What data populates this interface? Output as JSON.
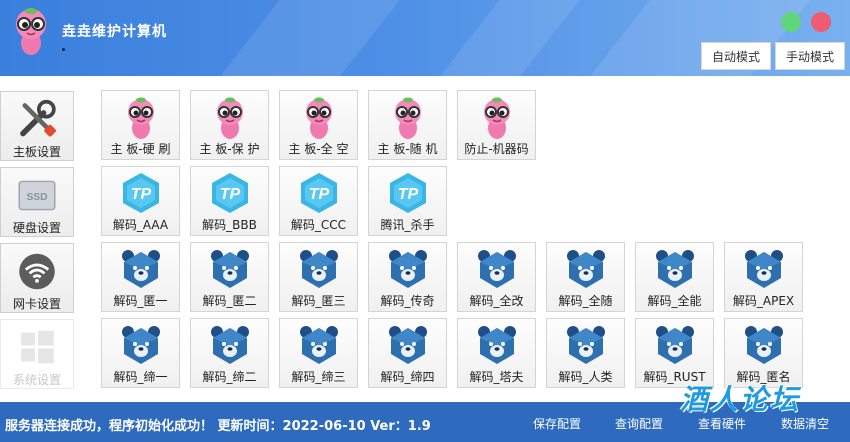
{
  "app": {
    "title": "垚垚维护计算机",
    "dot": "."
  },
  "window": {
    "buttons": [
      "green-button",
      "red-button"
    ]
  },
  "modes": {
    "auto": "自动模式",
    "manual": "手动模式"
  },
  "sidebar": [
    {
      "label": "主板设置",
      "icon": "tools-icon"
    },
    {
      "label": "硬盘设置",
      "icon": "ssd-icon"
    },
    {
      "label": "网卡设置",
      "icon": "wifi-icon"
    },
    {
      "label": "系统设置",
      "icon": "windows-icon"
    }
  ],
  "rows": [
    [
      {
        "label": "主 板-硬 刷",
        "icon": "mascot-icon"
      },
      {
        "label": "主 板-保 护",
        "icon": "mascot-icon"
      },
      {
        "label": "主 板-全 空",
        "icon": "mascot-icon"
      },
      {
        "label": "主 板-随 机",
        "icon": "mascot-icon"
      },
      {
        "label": "防止-机器码",
        "icon": "mascot-icon"
      }
    ],
    [
      {
        "label": "解码_AAA",
        "icon": "tp-icon"
      },
      {
        "label": "解码_BBB",
        "icon": "tp-icon"
      },
      {
        "label": "解码_CCC",
        "icon": "tp-icon"
      },
      {
        "label": "腾讯_杀手",
        "icon": "tp-icon"
      }
    ],
    [
      {
        "label": "解码_匿一",
        "icon": "bear-icon"
      },
      {
        "label": "解码_匿二",
        "icon": "bear-icon"
      },
      {
        "label": "解码_匿三",
        "icon": "bear-icon"
      },
      {
        "label": "解码_传奇",
        "icon": "bear-icon"
      },
      {
        "label": "解码_全改",
        "icon": "bear-icon"
      },
      {
        "label": "解码_全随",
        "icon": "bear-icon"
      },
      {
        "label": "解码_全能",
        "icon": "bear-icon"
      },
      {
        "label": "解码_APEX",
        "icon": "bear-icon"
      }
    ],
    [
      {
        "label": "解码_缔一",
        "icon": "bear-icon"
      },
      {
        "label": "解码_缔二",
        "icon": "bear-icon"
      },
      {
        "label": "解码_缔三",
        "icon": "bear-icon"
      },
      {
        "label": "解码_缔四",
        "icon": "bear-icon"
      },
      {
        "label": "解码_塔夫",
        "icon": "bear-icon"
      },
      {
        "label": "解码_人类",
        "icon": "bear-icon"
      },
      {
        "label": "解码_RUST",
        "icon": "bear-icon"
      },
      {
        "label": "解码_匿名",
        "icon": "bear-icon"
      }
    ]
  ],
  "status": {
    "message": "服务器连接成功，程序初始化成功！ 更新时间：2022-06-10 Ver：1.9",
    "buttons": [
      "保存配置",
      "查询配置",
      "查看硬件",
      "数据清空"
    ]
  },
  "watermark": "酒人论坛",
  "colors": {
    "header": "#3a7fdc",
    "statusbar": "#2e6bbf",
    "accent": "#1e9be0",
    "mascot": "#f07ab0",
    "bear": "#2e6fb0"
  }
}
